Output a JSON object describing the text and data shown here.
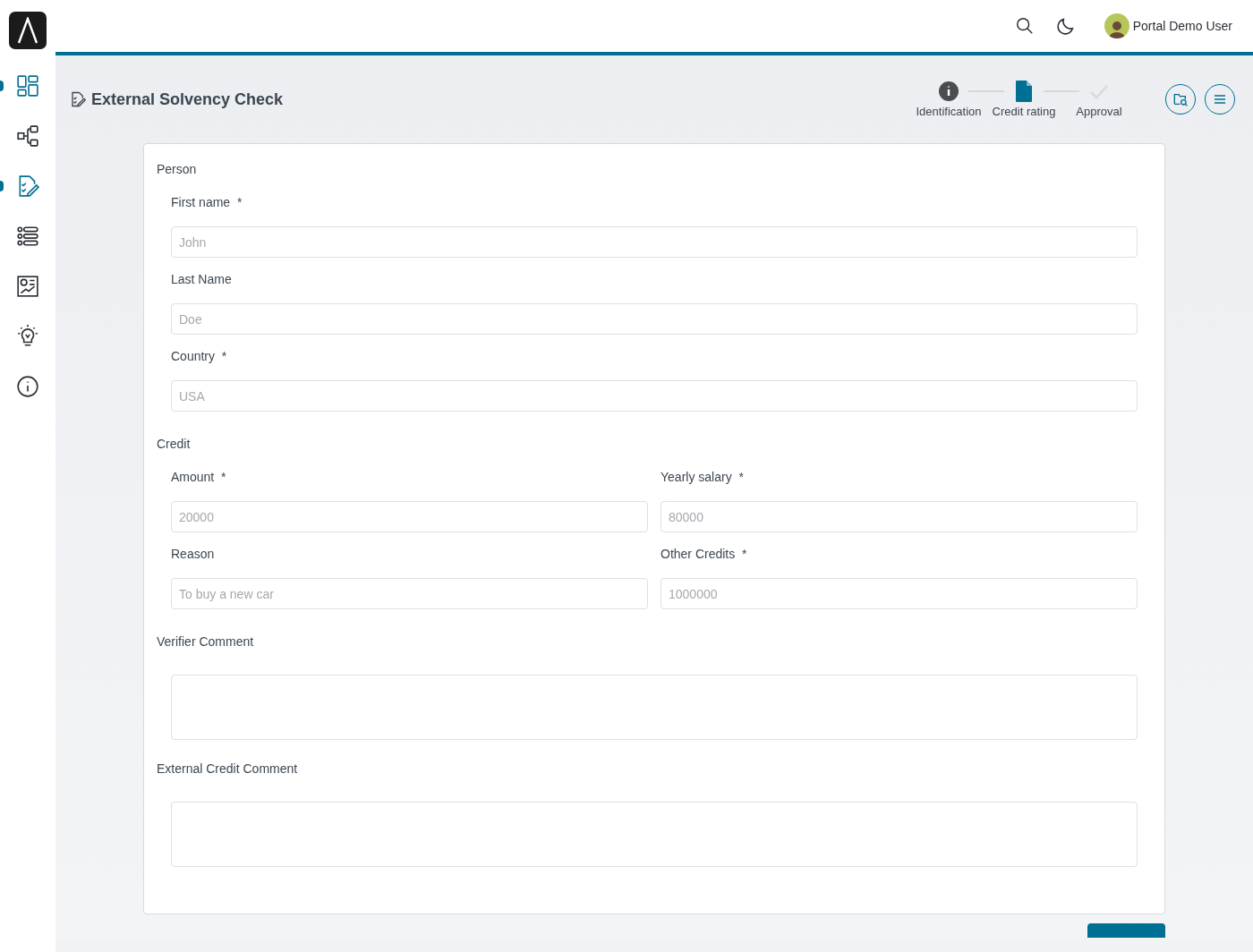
{
  "sidebar": {
    "items": [
      {
        "selected": true
      },
      {
        "selected": false
      },
      {
        "selected": true
      },
      {
        "selected": false
      },
      {
        "selected": false
      },
      {
        "selected": false
      },
      {
        "selected": false
      }
    ]
  },
  "topbar": {
    "user_name": "Portal Demo User"
  },
  "page": {
    "title": "External Solvency Check",
    "steps": [
      {
        "label": "Identification",
        "kind": "done"
      },
      {
        "label": "Credit rating",
        "kind": "current"
      },
      {
        "label": "Approval",
        "kind": "pending"
      }
    ]
  },
  "form": {
    "sections": [
      {
        "title": "Person",
        "kind": "single",
        "fields": [
          {
            "label": "First name",
            "required_mark": "*",
            "placeholder": "John",
            "kind": "input"
          },
          {
            "label": "Last Name",
            "placeholder": "Doe",
            "kind": "input"
          },
          {
            "label": "Country",
            "required_mark": "*",
            "placeholder": "USA",
            "kind": "input"
          }
        ]
      },
      {
        "title": "Credit",
        "kind": "pair",
        "fields": [
          {
            "label": "Amount",
            "required_mark": "*",
            "placeholder": "20000",
            "kind": "input"
          },
          {
            "label": "Yearly salary",
            "required_mark": "*",
            "placeholder": "80000",
            "kind": "input"
          },
          {
            "label": "Reason",
            "placeholder": "To buy a new car",
            "kind": "input"
          },
          {
            "label": "Other Credits",
            "required_mark": "*",
            "placeholder": "1000000",
            "kind": "input"
          }
        ]
      },
      {
        "title": "Verifier Comment",
        "kind": "single",
        "fields": [
          {
            "kind": "textarea"
          }
        ]
      },
      {
        "title": "External Credit Comment",
        "kind": "single",
        "fields": [
          {
            "kind": "textarea"
          }
        ]
      }
    ]
  }
}
